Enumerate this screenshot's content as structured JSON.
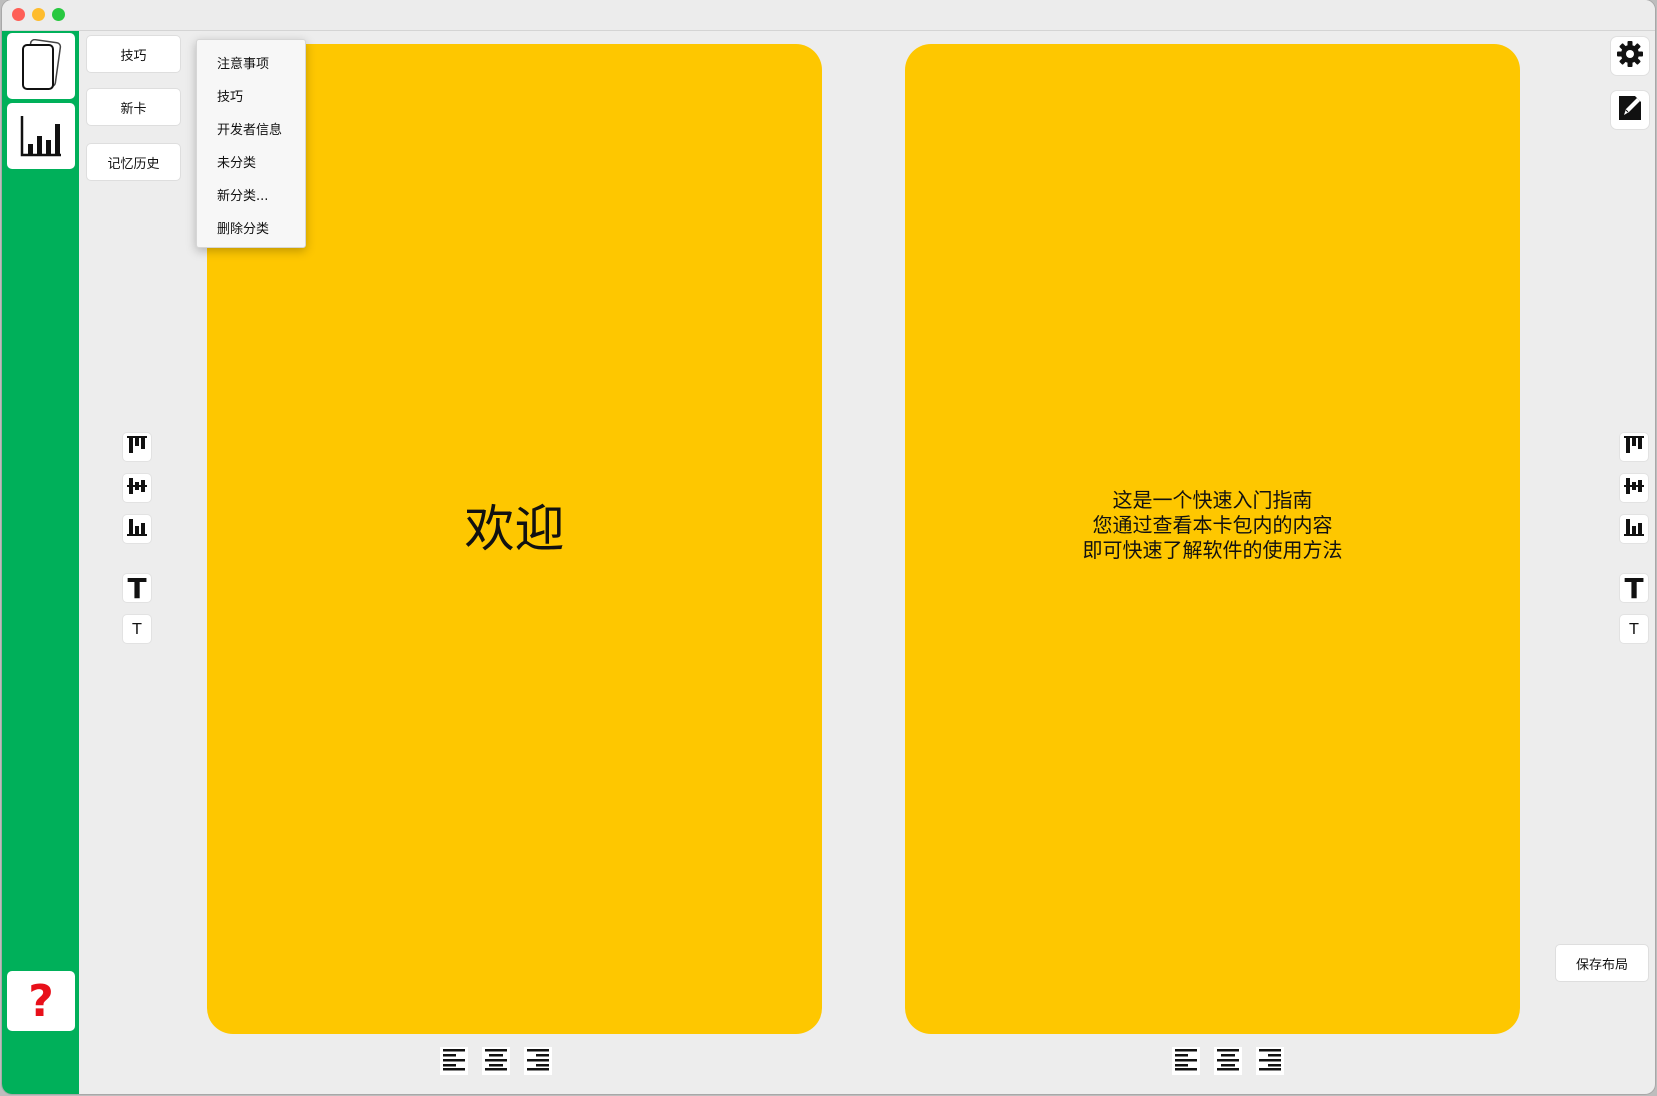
{
  "sidebar": {
    "items": [
      {
        "icon": "cards-icon"
      },
      {
        "icon": "statistics-icon"
      },
      {
        "icon": "help-icon"
      }
    ],
    "accent_color": "#00b05a"
  },
  "categories": {
    "buttons": [
      {
        "label": "技巧"
      },
      {
        "label": "新卡"
      },
      {
        "label": "记忆历史"
      }
    ]
  },
  "dropdown_menu": {
    "items": [
      {
        "label": "注意事项"
      },
      {
        "label": "技巧"
      },
      {
        "label": "开发者信息"
      },
      {
        "label": "未分类"
      },
      {
        "label": "新分类..."
      },
      {
        "label": "删除分类"
      }
    ]
  },
  "cards": {
    "front": {
      "text": "欢迎"
    },
    "back": {
      "text": "这是一个快速入门指南\n您通过查看本卡包内的内容\n即可快速了解软件的使用方法"
    },
    "color": "#fec700"
  },
  "toolbar": {
    "vertical_align_icons": [
      "align-top-icon",
      "align-middle-icon",
      "align-bottom-icon"
    ],
    "text_size": {
      "large_label": "T",
      "small_label": "T"
    },
    "horizontal_align_icons": [
      "align-left-icon",
      "align-center-icon",
      "align-right-icon"
    ]
  },
  "top_right": {
    "icons": [
      "gear-icon",
      "edit-note-icon"
    ]
  },
  "save_layout": {
    "label": "保存布局"
  }
}
